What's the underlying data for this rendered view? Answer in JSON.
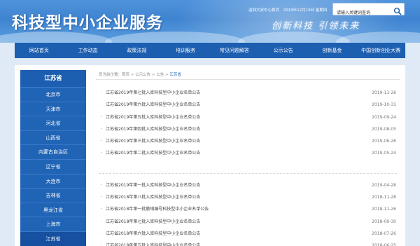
{
  "header": {
    "site_title": "科技型中小企业服务",
    "slogan": "创新科技  引领未来",
    "top_info": {
      "link": "返回大安中心首页",
      "date": "2019年12月19日 星期四"
    },
    "search": {
      "placeholder": "请输入关键词查询"
    }
  },
  "nav": {
    "items": [
      "网站首页",
      "工作动态",
      "政策法规",
      "培训服务",
      "常见问题解答",
      "公示公告",
      "创新基金",
      "中国创新创业大赛"
    ]
  },
  "sidebar": {
    "title": "江苏省",
    "items": [
      "北京市",
      "天津市",
      "河北省",
      "山西省",
      "内蒙古自治区",
      "辽宁省",
      "大连市",
      "吉林省",
      "黑龙江省",
      "上海市",
      "江苏省"
    ],
    "active_index": 10
  },
  "breadcrumb": {
    "prefix": "您当前位置：首页 > 公示公告 > 公告 > ",
    "current": "江苏省"
  },
  "list": {
    "group1": [
      {
        "title": "江苏省2019年第七批入库科技型中小企业名单公告",
        "date": "2019-11-26"
      },
      {
        "title": "江苏省2019年第六批入库科技型中小企业名单公告",
        "date": "2019-10-31"
      },
      {
        "title": "江苏省2019年第五批入库科技型中小企业名单公告",
        "date": "2019-09-24"
      },
      {
        "title": "江苏省2019年第四批入库科技型中小企业名单公告",
        "date": "2019-08-05"
      },
      {
        "title": "江苏省2019年第三批入库科技型中小企业名单公告",
        "date": "2019-06-26"
      },
      {
        "title": "江苏省2019年第二批入库科技型中小企业名单公告",
        "date": "2019-05-24"
      }
    ],
    "group2": [
      {
        "title": "江苏省2019年第一批入库科技型中小企业名单公告",
        "date": "2019-04-28"
      },
      {
        "title": "江苏省2018年第八批入库科技型中小企业名单公告",
        "date": "2018-11-28"
      },
      {
        "title": "江苏省2018年第一批撤销编号科技型中小企业名单公告",
        "date": "2018-11-26"
      },
      {
        "title": "江苏省2018年第七批入库科技型中小企业名单公告",
        "date": "2018-09-30"
      },
      {
        "title": "江苏省2018年第六批入库科技型中小企业名单公告",
        "date": "2018-07-26"
      },
      {
        "title": "江苏省2018年第五批入库科技型中小企业名单公告",
        "date": "2018-06-25"
      }
    ]
  },
  "colors": {
    "nav_bg": "#1c5eb0",
    "banner_bg": "#4f93dc",
    "link_active": "#1c5eb0"
  },
  "icons": {
    "search": "search-icon"
  }
}
